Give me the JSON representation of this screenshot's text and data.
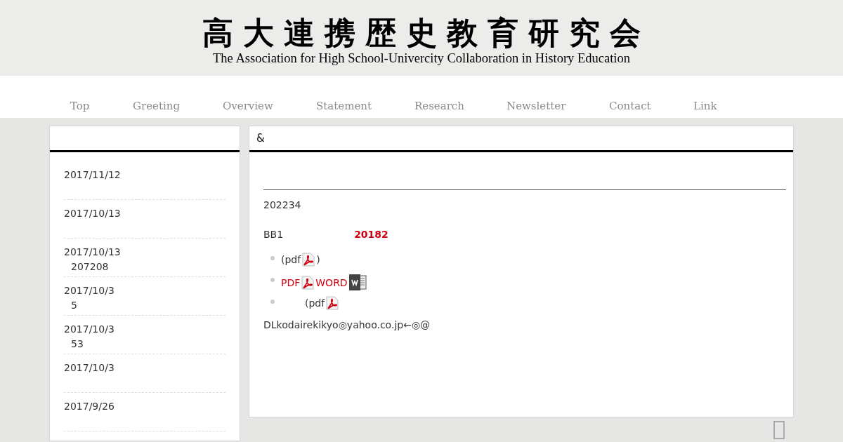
{
  "header": {
    "title": "高大連携歴史教育研究会",
    "subtitle": "The Association for High School-Univercity Collaboration in History Education"
  },
  "nav": [
    {
      "label": "Top"
    },
    {
      "label": "Greeting"
    },
    {
      "label": "Overview"
    },
    {
      "label": "Statement"
    },
    {
      "label": "Research"
    },
    {
      "label": "Newsletter"
    },
    {
      "label": "Contact"
    },
    {
      "label": "Link"
    }
  ],
  "sidebar": {
    "items": [
      {
        "date": "2017/11/12"
      },
      {
        "date": "2017/10/13"
      },
      {
        "date": "2017/10/13",
        "text": "207208"
      },
      {
        "date": "2017/10/3",
        "text": "5"
      },
      {
        "date": "2017/10/3",
        "text": "53"
      },
      {
        "date": "2017/10/3"
      },
      {
        "date": "2017/9/26"
      }
    ]
  },
  "main": {
    "title": "&",
    "paragraph_1": "202234",
    "paragraph_2": {
      "text": "BB1",
      "highlight": "20182"
    },
    "list": [
      {
        "kind": "plain",
        "parts": [
          {
            "kind": "text",
            "text": "(pdf"
          },
          {
            "kind": "pdf"
          },
          {
            "kind": "text",
            "text": ")"
          }
        ]
      },
      {
        "kind": "plain",
        "parts": [
          {
            "kind": "link",
            "text": "PDF"
          },
          {
            "kind": "pdf"
          },
          {
            "kind": "link",
            "text": "WORD"
          },
          {
            "kind": "word"
          }
        ]
      },
      {
        "kind": "indented",
        "parts": [
          {
            "kind": "text",
            "text": "(pdf"
          },
          {
            "kind": "pdf"
          }
        ]
      }
    ],
    "contact": "DLkodairekikyo◎yahoo.co.jp←◎@"
  }
}
